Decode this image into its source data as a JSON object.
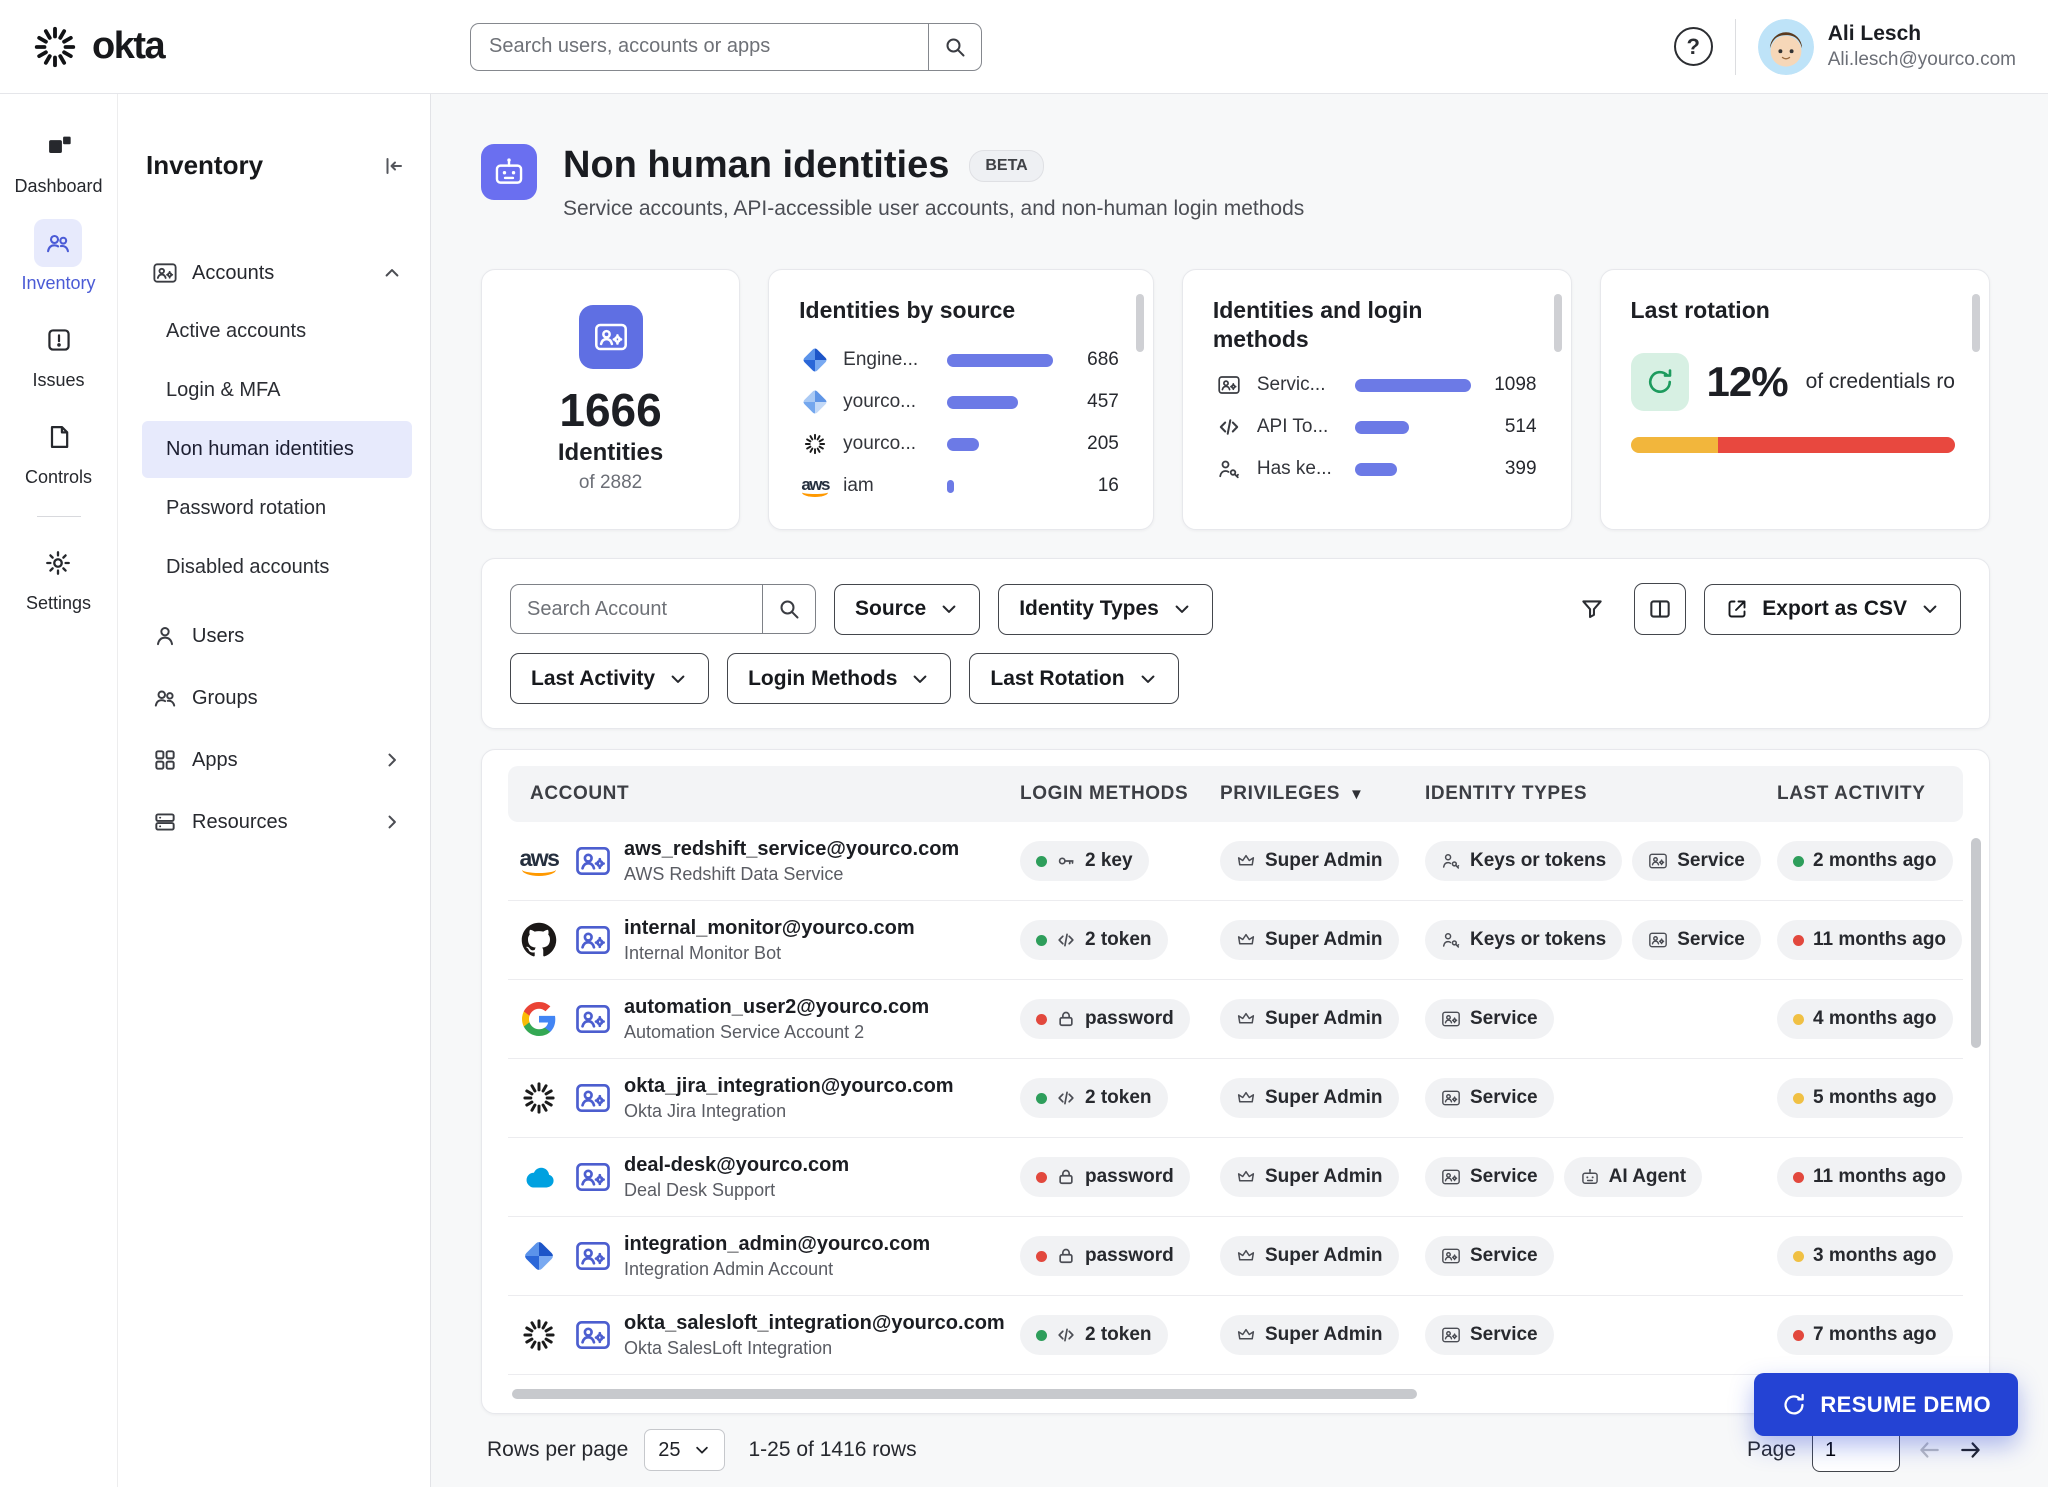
{
  "colors": {
    "accent_indigo": "#4C5BD6",
    "header_icon_bg": "#6A6FF0",
    "bar_blue": "#6C7AE6",
    "status_green": "#2E9E5B",
    "status_red": "#E2483D",
    "status_yellow": "#F0C043",
    "resume_bg": "#2443D4",
    "selected_bg": "#E7EAFC"
  },
  "topbar": {
    "brand": "okta",
    "search_placeholder": "Search users, accounts or apps",
    "help": "?",
    "user": {
      "name": "Ali Lesch",
      "email": "Ali.lesch@yourco.com"
    }
  },
  "rail": [
    {
      "label": "Dashboard"
    },
    {
      "label": "Inventory"
    },
    {
      "label": "Issues"
    },
    {
      "label": "Controls"
    },
    {
      "label": "Settings"
    }
  ],
  "sidebar": {
    "title": "Inventory",
    "accounts_label": "Accounts",
    "accounts_children": [
      {
        "label": "Active accounts"
      },
      {
        "label": "Login & MFA"
      },
      {
        "label": "Non human identities"
      },
      {
        "label": "Password rotation"
      },
      {
        "label": "Disabled accounts"
      }
    ],
    "items": [
      {
        "label": "Users"
      },
      {
        "label": "Groups"
      },
      {
        "label": "Apps"
      },
      {
        "label": "Resources"
      }
    ]
  },
  "page": {
    "title": "Non human identities",
    "beta": "BETA",
    "subtitle": "Service accounts, API-accessible user accounts, and non-human login methods"
  },
  "stats": {
    "identities": {
      "value": "1666",
      "label": "Identities",
      "sub": "of 2882"
    },
    "by_source": {
      "title": "Identities by source",
      "max": 686,
      "rows": [
        {
          "icon": "diamond-blue-icon",
          "label": "Engine...",
          "value": 686
        },
        {
          "icon": "diamond-light-icon",
          "label": "yourco...",
          "value": 457
        },
        {
          "icon": "okta-mark-icon",
          "label": "yourco...",
          "value": 205
        },
        {
          "icon": "aws-logo",
          "label": "iam",
          "value": 16
        }
      ]
    },
    "identities_login": {
      "title": "Identities and login methods",
      "max": 1098,
      "rows": [
        {
          "icon": "service-icon",
          "label": "Servic...",
          "value": 1098
        },
        {
          "icon": "code-icon",
          "label": "API To...",
          "value": 514
        },
        {
          "icon": "keys-icon",
          "label": "Has ke...",
          "value": 399
        }
      ]
    },
    "last_rotation": {
      "title": "Last rotation",
      "value": "12%",
      "caption": "of credentials ro",
      "segments": [
        {
          "color": "#F2B63C",
          "pct": 27
        },
        {
          "color": "#E8483F",
          "pct": 73
        }
      ]
    }
  },
  "filters": {
    "search_placeholder": "Search Account",
    "source": "Source",
    "identity_types": "Identity Types",
    "last_activity": "Last Activity",
    "login_methods": "Login Methods",
    "last_rotation": "Last Rotation",
    "export": "Export as CSV"
  },
  "table": {
    "columns": [
      "ACCOUNT",
      "LOGIN METHODS",
      "PRIVILEGES",
      "IDENTITY TYPES",
      "LAST ACTIVITY"
    ],
    "sort_column": "PRIVILEGES",
    "rows": [
      {
        "provider_logo": "aws-logo",
        "provider_text": "aws",
        "email": "aws_redshift_service@yourco.com",
        "name": "AWS Redshift Data Service",
        "login": {
          "dot_color": "#2E9E5B",
          "icon": "key-icon",
          "label": "2 key"
        },
        "privilege": {
          "icon": "crown-icon",
          "label": "Super Admin"
        },
        "identity_types": [
          {
            "icon": "keys-icon",
            "label": "Keys or tokens"
          },
          {
            "icon": "service-icon",
            "label": "Service"
          }
        ],
        "activity": {
          "dot_color": "#2E9E5B",
          "label": "2 months ago"
        }
      },
      {
        "provider_logo": "github-logo",
        "email": "internal_monitor@yourco.com",
        "name": "Internal Monitor Bot",
        "login": {
          "dot_color": "#2E9E5B",
          "icon": "code-icon",
          "label": "2 token"
        },
        "privilege": {
          "icon": "crown-icon",
          "label": "Super Admin"
        },
        "identity_types": [
          {
            "icon": "keys-icon",
            "label": "Keys or tokens"
          },
          {
            "icon": "service-icon",
            "label": "Service"
          }
        ],
        "activity": {
          "dot_color": "#E2483D",
          "label": "11 months ago"
        }
      },
      {
        "provider_logo": "google-logo",
        "email": "automation_user2@yourco.com",
        "name": "Automation Service Account 2",
        "login": {
          "dot_color": "#E2483D",
          "icon": "lock-icon",
          "label": "password"
        },
        "privilege": {
          "icon": "crown-icon",
          "label": "Super Admin"
        },
        "identity_types": [
          {
            "icon": "service-icon",
            "label": "Service"
          }
        ],
        "activity": {
          "dot_color": "#F0C043",
          "label": "4 months ago"
        }
      },
      {
        "provider_logo": "okta-logo",
        "email": "okta_jira_integration@yourco.com",
        "name": "Okta Jira Integration",
        "login": {
          "dot_color": "#2E9E5B",
          "icon": "code-icon",
          "label": "2 token"
        },
        "privilege": {
          "icon": "crown-icon",
          "label": "Super Admin"
        },
        "identity_types": [
          {
            "icon": "service-icon",
            "label": "Service"
          }
        ],
        "activity": {
          "dot_color": "#F0C043",
          "label": "5 months ago"
        }
      },
      {
        "provider_logo": "salesforce-logo",
        "email": "deal-desk@yourco.com",
        "name": "Deal Desk Support",
        "login": {
          "dot_color": "#E2483D",
          "icon": "lock-icon",
          "label": "password"
        },
        "privilege": {
          "icon": "crown-icon",
          "label": "Super Admin"
        },
        "identity_types": [
          {
            "icon": "service-icon",
            "label": "Service"
          },
          {
            "icon": "ai-agent-icon",
            "label": "AI Agent"
          }
        ],
        "activity": {
          "dot_color": "#E2483D",
          "label": "11 months ago"
        }
      },
      {
        "provider_logo": "diamond-logo",
        "email": "integration_admin@yourco.com",
        "name": "Integration Admin Account",
        "login": {
          "dot_color": "#E2483D",
          "icon": "lock-icon",
          "label": "password"
        },
        "privilege": {
          "icon": "crown-icon",
          "label": "Super Admin"
        },
        "identity_types": [
          {
            "icon": "service-icon",
            "label": "Service"
          }
        ],
        "activity": {
          "dot_color": "#F0C043",
          "label": "3 months ago"
        }
      },
      {
        "provider_logo": "okta-logo",
        "email": "okta_salesloft_integration@yourco.com",
        "name": "Okta SalesLoft Integration",
        "login": {
          "dot_color": "#2E9E5B",
          "icon": "code-icon",
          "label": "2 token"
        },
        "privilege": {
          "icon": "crown-icon",
          "label": "Super Admin"
        },
        "identity_types": [
          {
            "icon": "service-icon",
            "label": "Service"
          }
        ],
        "activity": {
          "dot_color": "#E2483D",
          "label": "7 months ago"
        }
      }
    ]
  },
  "footer": {
    "rows_per_page_label": "Rows per page",
    "rows_per_page": "25",
    "range": "1-25 of 1416 rows",
    "page_label": "Page",
    "page": "1"
  },
  "resume": "RESUME DEMO"
}
